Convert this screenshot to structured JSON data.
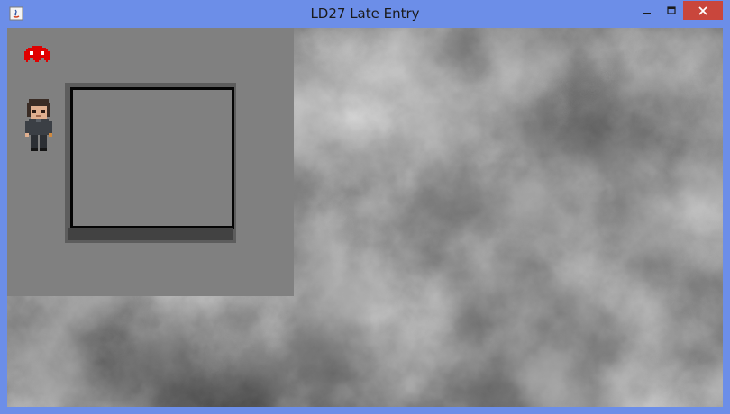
{
  "window": {
    "title": "LD27 Late Entry"
  },
  "titlebar_buttons": {
    "minimize_icon": "minimize-icon",
    "maximize_icon": "maximize-icon",
    "close_icon": "close-icon"
  },
  "game": {
    "panel_color": "#808080",
    "ghost_color": "#e00000",
    "sprites": [
      "ghost-enemy",
      "player-character"
    ],
    "item_slot": "empty"
  }
}
